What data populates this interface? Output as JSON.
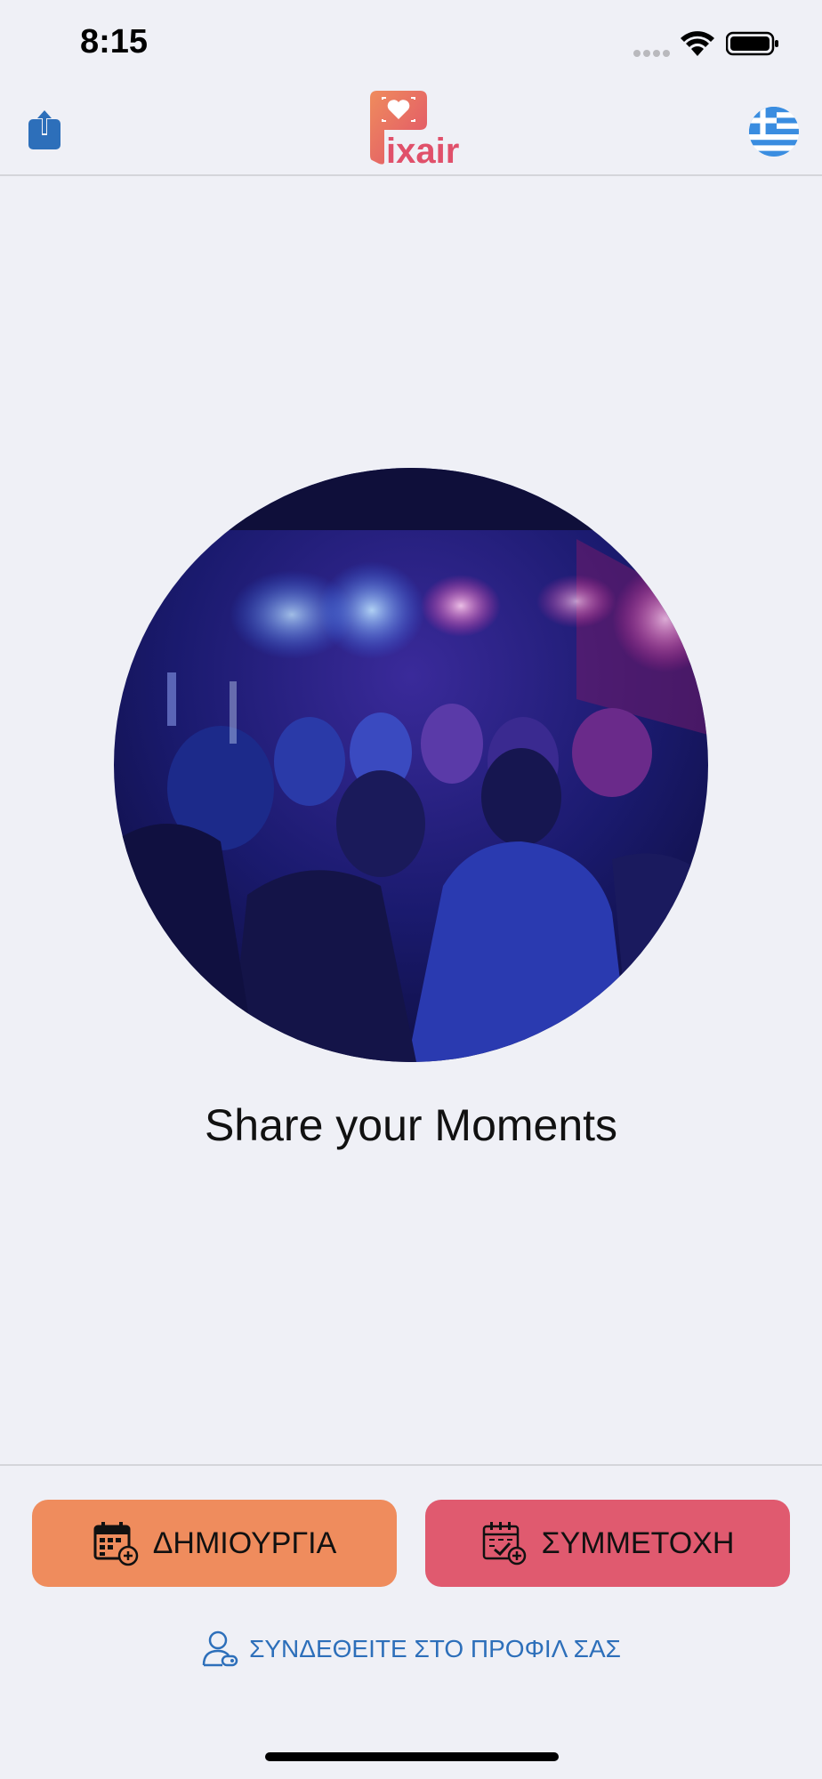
{
  "status_bar": {
    "time": "8:15"
  },
  "header": {
    "logo_text": "ixair"
  },
  "main": {
    "tagline": "Share your Moments"
  },
  "actions": {
    "create_label": "ΔΗΜΙΟΥΡΓΙΑ",
    "join_label": "ΣΥΜΜΕΤΟΧΗ",
    "login_label": "ΣΥΝΔΕΘΕΙΤΕ ΣΤΟ ΠΡΟΦΙΛ ΣΑΣ"
  },
  "colors": {
    "background": "#eff0f6",
    "create_button": "#ef8c5d",
    "join_button": "#e05a6f",
    "link": "#2d6fba",
    "share_icon": "#2d6fba",
    "logo": "#e0506a"
  }
}
